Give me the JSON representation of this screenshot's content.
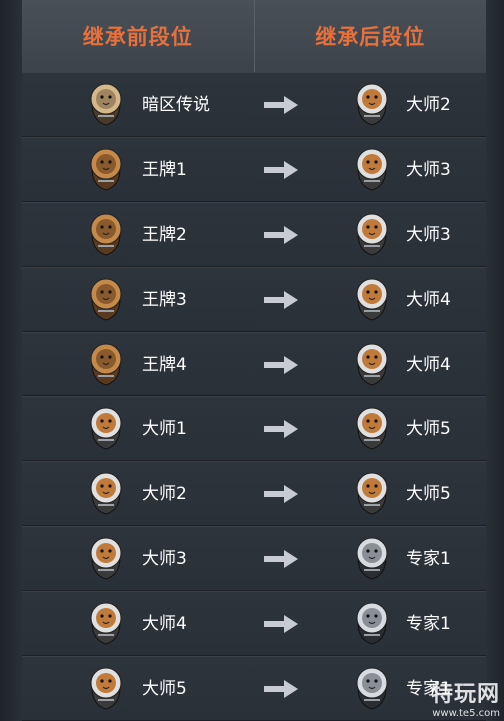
{
  "header": {
    "before_label": "继承前段位",
    "after_label": "继承后段位"
  },
  "rows": [
    {
      "from": "暗区传说",
      "to": "大师2",
      "from_icon": "legend-crest-icon",
      "to_icon": "tiger-badge-icon"
    },
    {
      "from": "王牌1",
      "to": "大师3",
      "from_icon": "lion-badge-icon",
      "to_icon": "tiger-badge-icon"
    },
    {
      "from": "王牌2",
      "to": "大师3",
      "from_icon": "lion-badge-icon",
      "to_icon": "tiger-badge-icon"
    },
    {
      "from": "王牌3",
      "to": "大师4",
      "from_icon": "lion-badge-icon",
      "to_icon": "tiger-badge-icon"
    },
    {
      "from": "王牌4",
      "to": "大师4",
      "from_icon": "lion-badge-icon",
      "to_icon": "tiger-badge-icon"
    },
    {
      "from": "大师1",
      "to": "大师5",
      "from_icon": "tiger-badge-icon",
      "to_icon": "tiger-badge-icon"
    },
    {
      "from": "大师2",
      "to": "大师5",
      "from_icon": "tiger-badge-icon",
      "to_icon": "tiger-badge-icon"
    },
    {
      "from": "大师3",
      "to": "专家1",
      "from_icon": "tiger-badge-icon",
      "to_icon": "wolf-badge-icon"
    },
    {
      "from": "大师4",
      "to": "专家1",
      "from_icon": "tiger-badge-icon",
      "to_icon": "wolf-badge-icon"
    },
    {
      "from": "大师5",
      "to": "专家1",
      "from_icon": "tiger-badge-icon",
      "to_icon": "wolf-badge-icon"
    }
  ],
  "watermark": {
    "name": "特玩网",
    "url": "www.te5.com"
  },
  "colors": {
    "header_text": "#e8703a",
    "row_text": "#ffffff",
    "arrow": "#c8ccd2"
  }
}
